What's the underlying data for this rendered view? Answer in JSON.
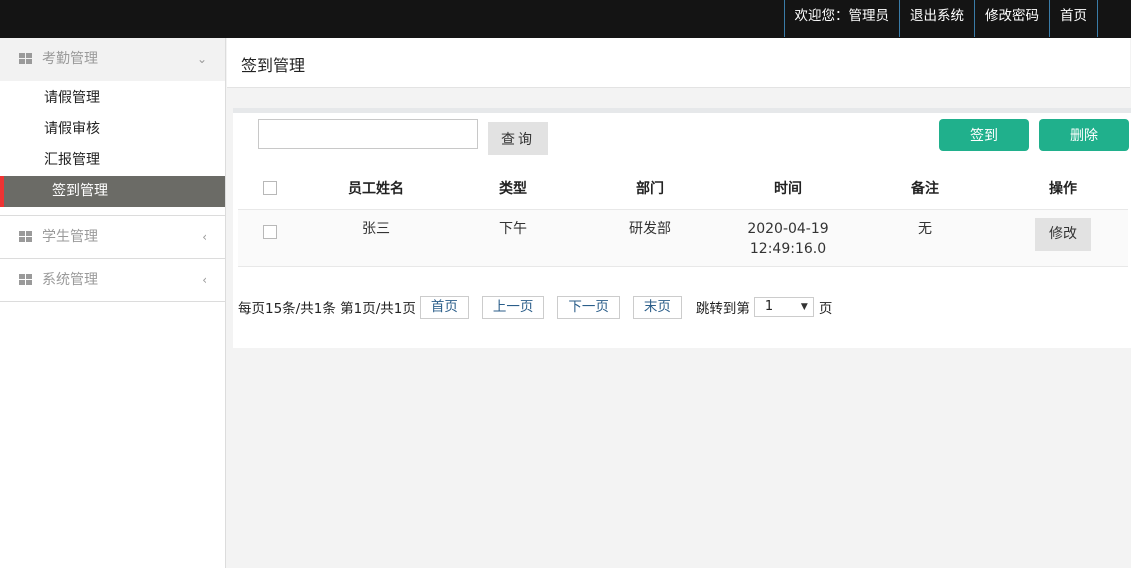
{
  "topnav": {
    "welcome": "欢迎您：管理员",
    "logout": "退出系统",
    "change_password": "修改密码",
    "home": "首页"
  },
  "sidebar": {
    "groups": [
      {
        "label": "考勤管理",
        "icon": "grid-icon",
        "state": "expanded",
        "items": [
          {
            "label": "请假管理"
          },
          {
            "label": "请假审核"
          },
          {
            "label": "汇报管理"
          },
          {
            "label": "签到管理",
            "active": true
          }
        ]
      },
      {
        "label": "学生管理",
        "icon": "grid-icon",
        "state": "collapsed"
      },
      {
        "label": "系统管理",
        "icon": "grid-icon",
        "state": "collapsed"
      }
    ]
  },
  "page": {
    "title": "签到管理"
  },
  "toolbar": {
    "search_value": "",
    "search_button": "查询",
    "checkin_button": "签到",
    "delete_button": "删除"
  },
  "table": {
    "headers": [
      "员工姓名",
      "类型",
      "部门",
      "时间",
      "备注",
      "操作"
    ],
    "rows": [
      {
        "name": "张三",
        "type": "下午",
        "department": "研发部",
        "time_date": "2020-04-19",
        "time_clock": "12:49:16.0",
        "remark": "无",
        "action": "修改"
      }
    ]
  },
  "pagination": {
    "summary": "每页15条/共1条 第1页/共1页",
    "first": "首页",
    "prev": "上一页",
    "next": "下一页",
    "last": "末页",
    "jump_label": "跳转到第",
    "selected_page": "1",
    "unit": "页"
  },
  "colors": {
    "topbar": "#141414",
    "accent_green": "#20b08c",
    "active_item_bg": "#6b6b66",
    "active_marker": "#ee3333"
  }
}
